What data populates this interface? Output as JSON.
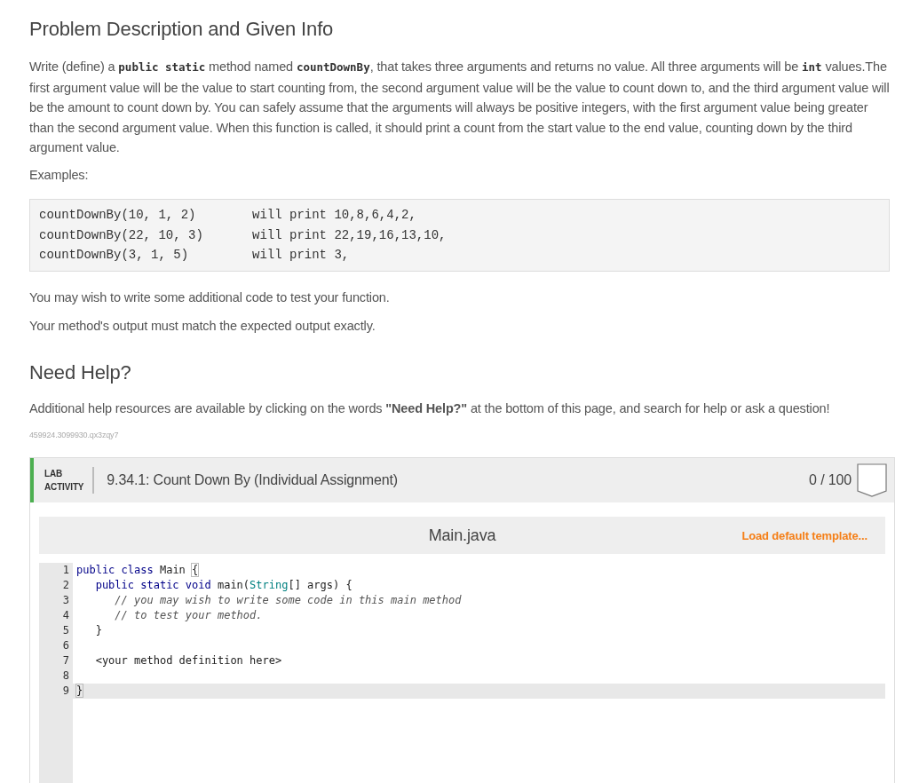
{
  "heading": "Problem Description and Given Info",
  "description": [
    {
      "kind": "text",
      "text": "Write (define) a "
    },
    {
      "kind": "code",
      "text": "public static"
    },
    {
      "kind": "text",
      "text": " method named "
    },
    {
      "kind": "code",
      "text": "countDownBy"
    },
    {
      "kind": "text",
      "text": ", that takes three arguments and returns no value. All three arguments will be "
    },
    {
      "kind": "code",
      "text": "int"
    },
    {
      "kind": "text",
      "text": " values.The first argument value will be the value to start counting from, the second argument value will be the value to count down to, and the third argument value will be the amount to count down by. You can safely assume that the arguments will always be positive integers, with the first argument value being greater than the second argument value. When this function is called, it should print a count from the start value to the end value, counting down by the third argument value."
    }
  ],
  "examples_label": "Examples:",
  "examples": [
    {
      "call": "countDownBy(10, 1, 2)",
      "result": "will print 10,8,6,4,2,"
    },
    {
      "call": "countDownBy(22, 10, 3)",
      "result": "will print 22,19,16,13,10,"
    },
    {
      "call": "countDownBy(3, 1, 5)",
      "result": "will print 3,"
    }
  ],
  "notes": [
    "You may wish to write some additional code to test your function.",
    "Your method's output must match the expected output exactly."
  ],
  "help_heading": "Need Help?",
  "help_text": "Additional help resources are available by clicking on the words **\"Need Help?\"** at the bottom of this page, and search for help or ask a question!",
  "id_code": "459924.3099930.qx3zqy7",
  "lab": {
    "label_lines": [
      "LAB",
      "ACTIVITY"
    ],
    "title": "9.34.1: Count Down By (Individual Assignment)",
    "score": "0 / 100"
  },
  "editor": {
    "filename": "Main.java",
    "template_link": "Load default template...",
    "lines": [
      {
        "number": "1",
        "active": false,
        "tokens": [
          {
            "kind": "keyword",
            "text": "public class"
          },
          {
            "kind": "plain",
            "text": " Main "
          },
          {
            "kind": "bracket",
            "text": "{"
          }
        ]
      },
      {
        "number": "2",
        "active": false,
        "tokens": [
          {
            "kind": "keyword",
            "text": "   public static void"
          },
          {
            "kind": "plain",
            "text": " main("
          },
          {
            "kind": "type",
            "text": "String"
          },
          {
            "kind": "plain",
            "text": "[] args) {"
          }
        ]
      },
      {
        "number": "3",
        "active": false,
        "tokens": [
          {
            "kind": "comment",
            "text": "      // you may wish to write some code in this main method"
          }
        ]
      },
      {
        "number": "4",
        "active": false,
        "tokens": [
          {
            "kind": "comment",
            "text": "      // to test your method."
          }
        ]
      },
      {
        "number": "5",
        "active": false,
        "tokens": [
          {
            "kind": "plain",
            "text": "   }"
          }
        ]
      },
      {
        "number": "6",
        "active": false
      },
      {
        "number": "7",
        "active": false,
        "tokens": [
          {
            "kind": "plain",
            "text": "   <your method definition here>"
          }
        ]
      },
      {
        "number": "8",
        "active": false
      },
      {
        "number": "9",
        "active": true,
        "tokens": [
          {
            "kind": "bracket",
            "text": "}"
          }
        ]
      }
    ]
  }
}
